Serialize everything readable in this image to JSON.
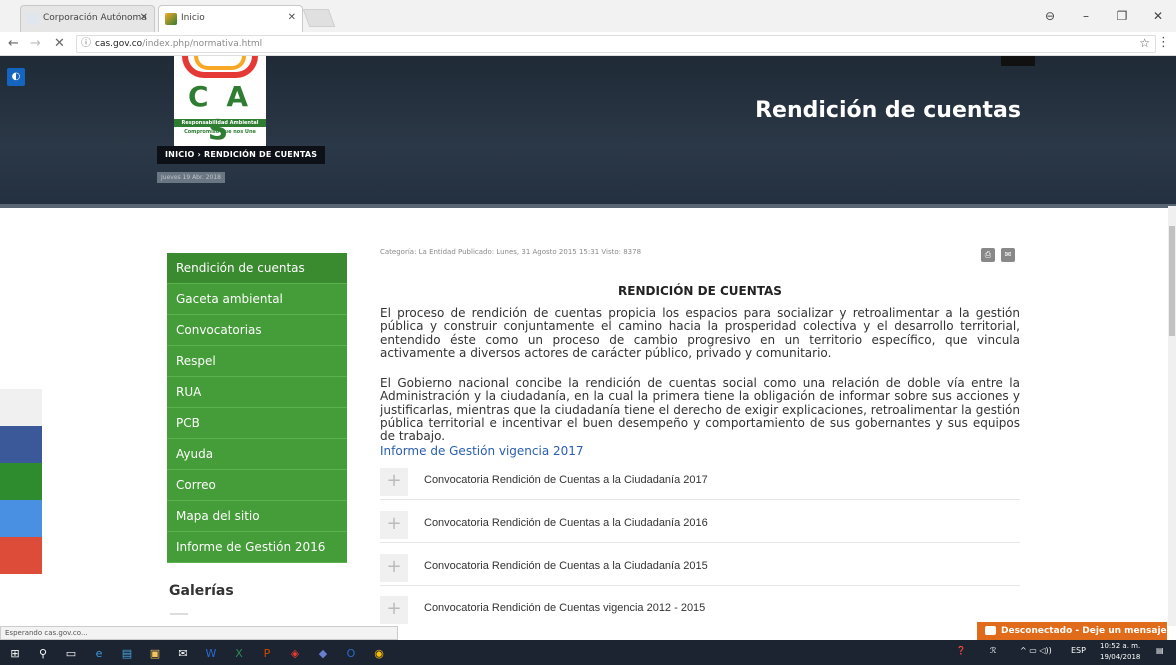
{
  "browser": {
    "tabs": [
      {
        "title": "Corporación Autónoma",
        "active": false
      },
      {
        "title": "Inicio",
        "active": true
      }
    ],
    "url_host": "cas.gov.co",
    "url_path": "/index.php/normativa.html",
    "window_controls": [
      "account-icon",
      "minimize",
      "maximize",
      "close"
    ]
  },
  "hero": {
    "logo_text": "C A S",
    "logo_sub1": "Responsabilidad Ambiental",
    "logo_sub2": "Compromiso que nos Une",
    "title": "Rendición de cuentas",
    "breadcrumb": "INICIO  ›  RENDICIÓN DE CUENTAS",
    "date": "Jueves 19 Abr. 2018"
  },
  "social_colors": [
    "#f0f0f0",
    "#3b5998",
    "#2e8b2e",
    "#4a90e2",
    "#dd4b39"
  ],
  "sidebar": {
    "items": [
      "Rendición de cuentas",
      "Gaceta ambiental",
      "Convocatorias",
      "Respel",
      "RUA",
      "PCB",
      "Ayuda",
      "Correo",
      "Mapa del sitio",
      "Informe de Gestión 2016"
    ],
    "galerias": "Galerías"
  },
  "article": {
    "meta": "Categoría: La Entidad    Publicado: Lunes, 31 Agosto 2015 15:31    Visto: 8378",
    "heading": "RENDICIÓN DE CUENTAS",
    "paragraph1": "El proceso de rendición de cuentas propicia los espacios para socializar y retroalimentar a la gestión pública y construir conjuntamente el camino hacia la prosperidad colectiva y el desarrollo territorial, entendido éste como un proceso de cambio progresivo en un territorio específico, que vincula activamente a diversos actores de carácter público, privado y comunitario.",
    "paragraph2": "El Gobierno nacional concibe la rendición de cuentas social como una relación de doble vía entre la Administración y la ciudadanía, en la cual la primera tiene la obligación de informar sobre sus acciones y justificarlas, mientras que la ciudadanía tiene el derecho de exigir explicaciones, retroalimentar la gestión pública territorial e incentivar el buen desempeño y comportamiento de sus gobernantes y sus equipos de trabajo.",
    "link": "Informe de Gestión vigencia 2017",
    "accordion": [
      "Convocatoria Rendición de Cuentas a la Ciudadanía 2017",
      "Convocatoria Rendición de Cuentas a la Ciudadanía 2016",
      "Convocatoria Rendición de Cuentas a la Ciudadanía 2015",
      "Convocatoria Rendición de Cuentas vigencia 2012 - 2015"
    ]
  },
  "status_bar": "Esperando cas.gov.co...",
  "chat": "Desconectado - Deje un mensaje",
  "taskbar": {
    "lang": "ESP",
    "time": "10:52 a. m.",
    "date": "19/04/2018"
  }
}
